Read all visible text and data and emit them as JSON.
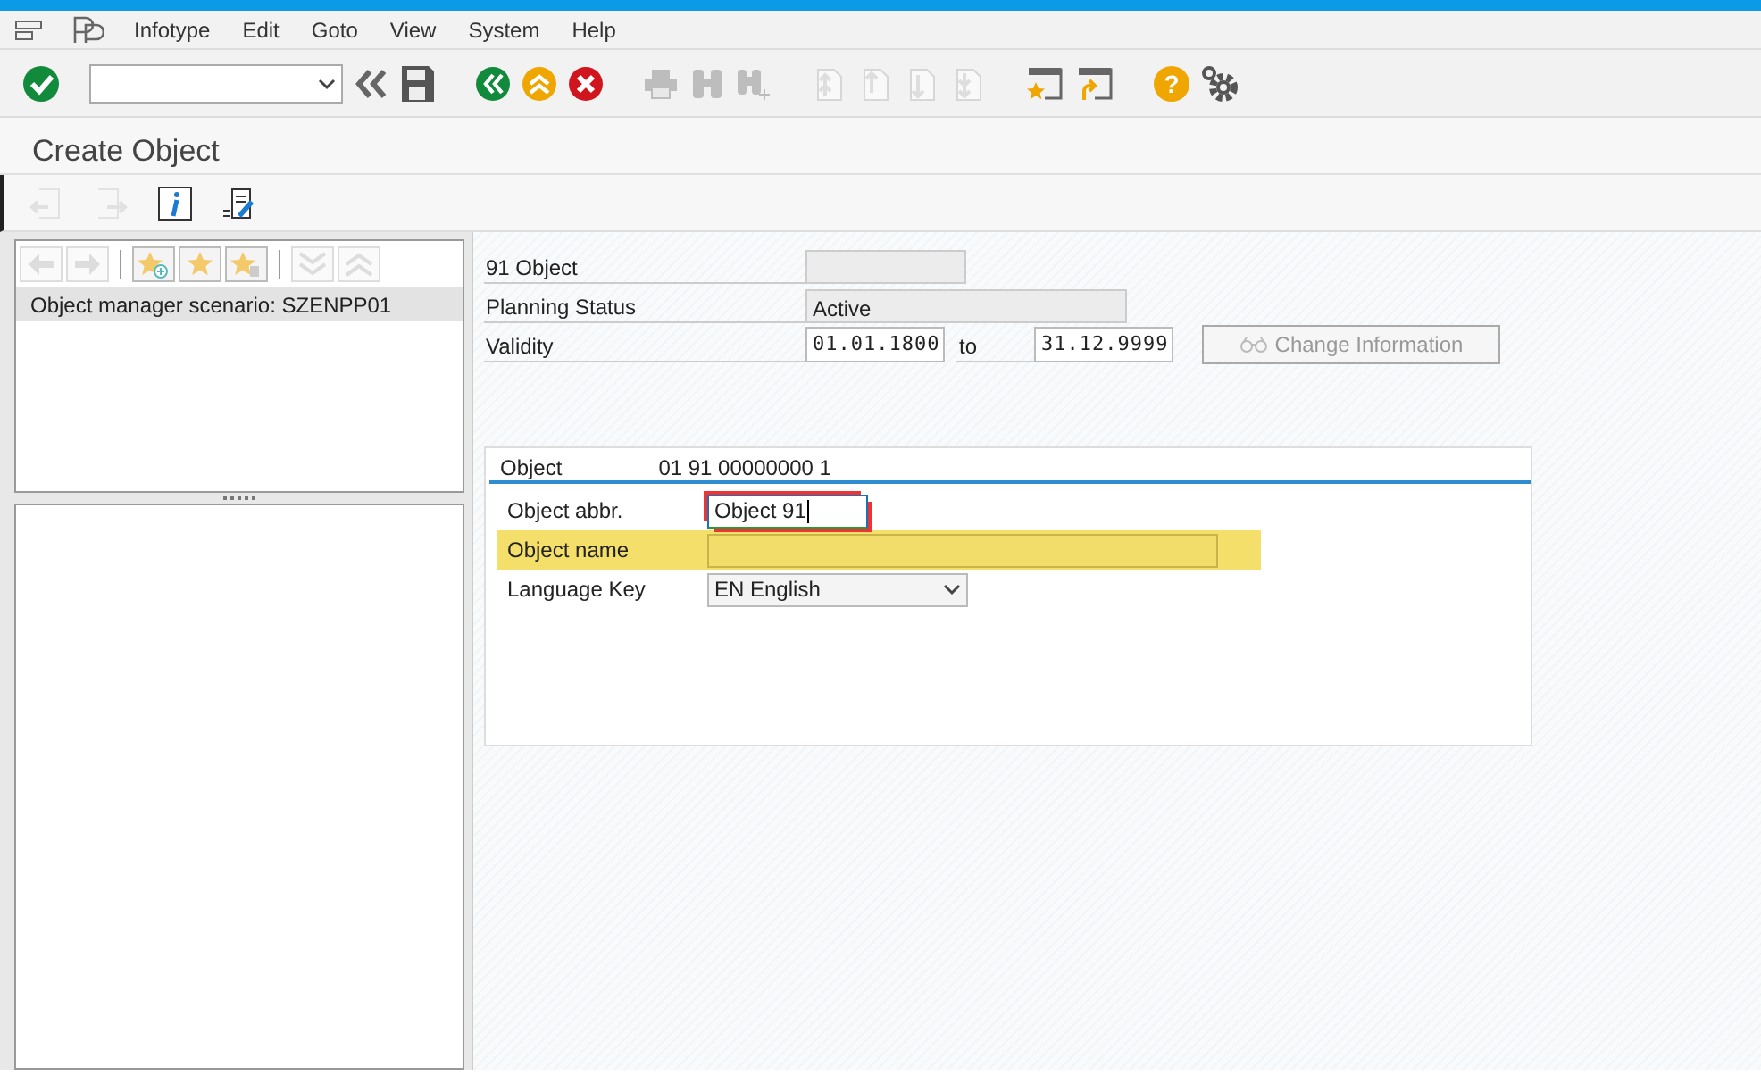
{
  "menu_bar": {
    "items": [
      "Infotype",
      "Edit",
      "Goto",
      "View",
      "System",
      "Help"
    ]
  },
  "toolbar": [
    {
      "kind": "enter",
      "disabled": false
    },
    {
      "kind": "command-field",
      "disabled": false
    },
    {
      "kind": "chevrons-left",
      "disabled": false
    },
    {
      "kind": "save",
      "disabled": false
    },
    {
      "kind": "back",
      "disabled": false
    },
    {
      "kind": "exit",
      "disabled": false
    },
    {
      "kind": "cancel",
      "disabled": false
    },
    {
      "kind": "print",
      "disabled": true
    },
    {
      "kind": "find",
      "disabled": true
    },
    {
      "kind": "find-next",
      "disabled": true
    },
    {
      "kind": "first-page",
      "disabled": true
    },
    {
      "kind": "prev-page",
      "disabled": true
    },
    {
      "kind": "next-page",
      "disabled": true
    },
    {
      "kind": "last-page",
      "disabled": true
    },
    {
      "kind": "new-session",
      "disabled": false
    },
    {
      "kind": "shortcut",
      "disabled": false
    },
    {
      "kind": "help",
      "symbol": "?",
      "disabled": false
    },
    {
      "kind": "settings",
      "disabled": false
    }
  ],
  "title": "Create Object",
  "app_toolbar": [
    {
      "kind": "previous",
      "disabled": true
    },
    {
      "kind": "next",
      "disabled": true
    },
    {
      "kind": "info",
      "disabled": false
    },
    {
      "kind": "notes",
      "disabled": false
    }
  ],
  "navigator": {
    "toolbar": [
      {
        "kind": "arrow-left",
        "disabled": true
      },
      {
        "kind": "arrow-right",
        "disabled": true
      },
      {
        "kind": "add-favorite",
        "disabled": false
      },
      {
        "kind": "favorite",
        "disabled": false
      },
      {
        "kind": "delete-favorite",
        "disabled": false
      },
      {
        "kind": "expand-all",
        "disabled": true
      },
      {
        "kind": "collapse-all",
        "disabled": true
      }
    ],
    "node": {
      "text": "Object manager scenario: SZENPP01",
      "selected": true
    }
  },
  "header": {
    "object_label": "91 Object",
    "planning_status_label": "Planning Status",
    "planning_status": "Active",
    "validity_label": "Validity",
    "valid_from": "01.01.1800",
    "to_label": "to",
    "valid_to": "31.12.9999",
    "change_info_button": "Change Information"
  },
  "object_section": {
    "label": "Object",
    "value": "01 91 00000000 1",
    "fields": [
      {
        "kind": "input",
        "label": "Object abbr.",
        "value": "Object 91",
        "focused": true,
        "highlighted": false
      },
      {
        "kind": "input",
        "label": "Object name",
        "focused": false,
        "highlighted": true
      },
      {
        "kind": "select",
        "label": "Language Key",
        "value": "EN English",
        "focused": false,
        "highlighted": false
      }
    ]
  }
}
